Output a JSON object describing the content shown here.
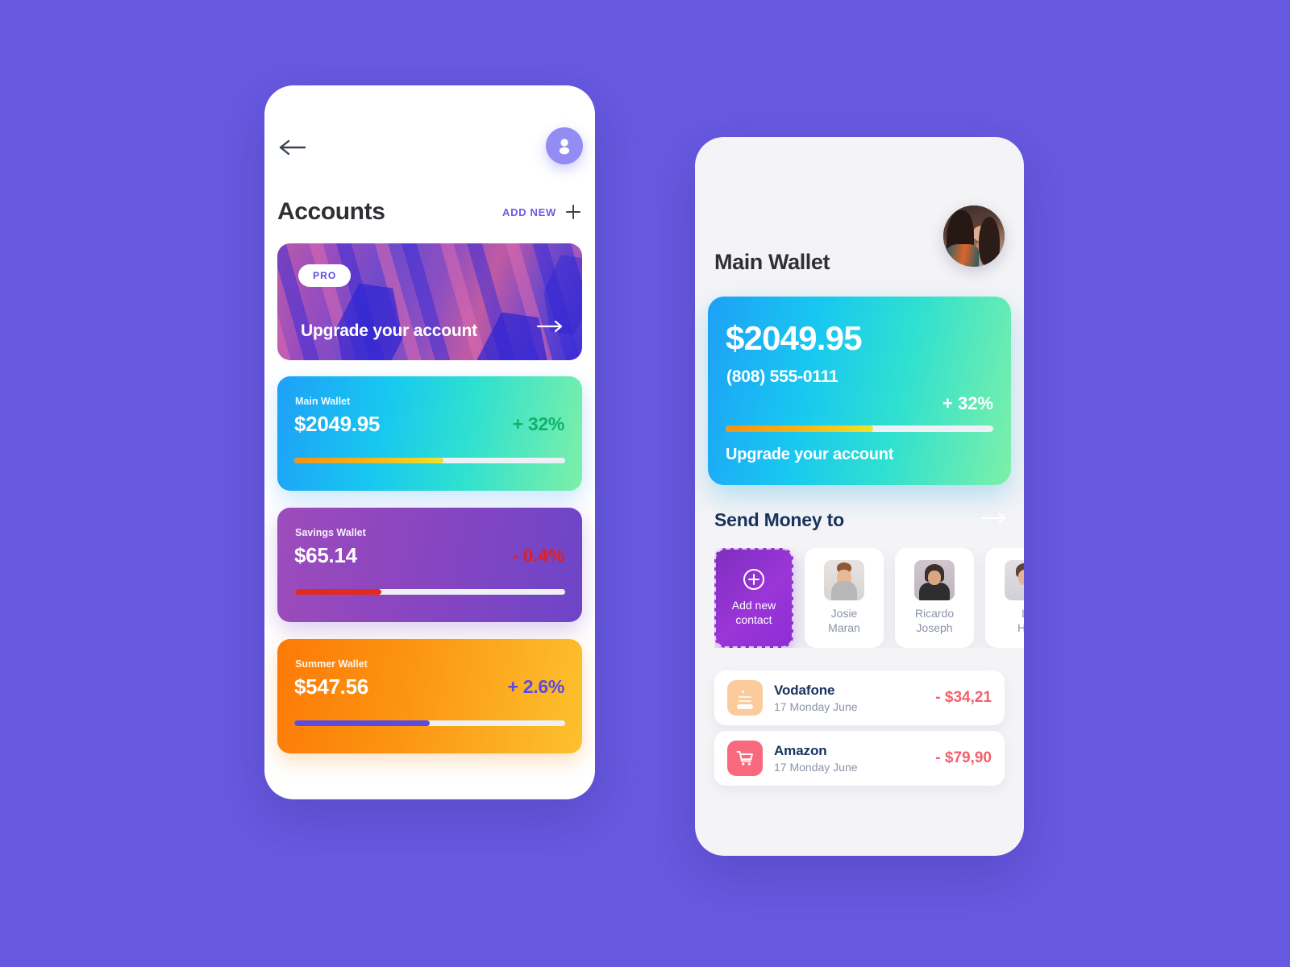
{
  "theme": {
    "background": "#6759E0",
    "accent_purple": "#6C5CE7",
    "positive_green": "#0FB36C",
    "negative_red": "#E02020",
    "txn_red": "#F4606C",
    "dark_navy": "#17325C",
    "muted_gray": "#8A93A8"
  },
  "accounts_screen": {
    "back_icon": "arrow-left-icon",
    "profile_icon": "person-icon",
    "title": "Accounts",
    "add_new_label": "ADD NEW",
    "add_new_icon": "plus-icon",
    "promo": {
      "badge": "PRO",
      "cta": "Upgrade your account",
      "arrow_icon": "arrow-right-icon"
    },
    "wallets": [
      {
        "name": "Main Wallet",
        "amount": "$2049.95",
        "delta": "+ 32%",
        "delta_sign": "positive",
        "progress_percent": 55,
        "bar_color": "#F3B019",
        "card_colors": [
          "#1EA0F7",
          "#7DF0A8"
        ]
      },
      {
        "name": "Savings Wallet",
        "amount": "$65.14",
        "delta": "- 0.4%",
        "delta_sign": "negative",
        "progress_percent": 32,
        "bar_color": "#E12B20",
        "card_colors": [
          "#9D4CBB",
          "#6D45C9"
        ]
      },
      {
        "name": "Summer Wallet",
        "amount": "$547.56",
        "delta": "+ 2.6%",
        "delta_sign": "neutral",
        "progress_percent": 50,
        "bar_color": "#5B4BE0",
        "card_colors": [
          "#FC7A07",
          "#FCC12E"
        ]
      }
    ]
  },
  "wallet_screen": {
    "avatar_icon": "user-avatar-photo",
    "title": "Main Wallet",
    "hero": {
      "amount": "$2049.95",
      "phone": "(808) 555-0111",
      "delta": "+ 32%",
      "progress_percent": 55,
      "cta": "Upgrade your account"
    },
    "send_money": {
      "title": "Send Money to",
      "arrow_icon": "arrow-right-icon",
      "add_contact": {
        "label": "Add new\ncontact",
        "label_line1": "Add new",
        "label_line2": "contact",
        "icon": "plus-circle-icon"
      },
      "contacts": [
        {
          "line1": "Josie",
          "line2": "Maran",
          "photo": "woman-bun-photo"
        },
        {
          "line1": "Ricardo",
          "line2": "Joseph",
          "photo": "man-beard-photo"
        },
        {
          "line1": "L",
          "line2": "Hu",
          "photo": "person-photo"
        }
      ]
    },
    "transactions": [
      {
        "merchant": "Vodafone",
        "date": "17 Monday June",
        "amount": "- $34,21",
        "icon": "receipt-icon",
        "icon_color": "#FBCB9C"
      },
      {
        "merchant": "Amazon",
        "date": "17 Monday June",
        "amount": "- $79,90",
        "icon": "shopping-cart-icon",
        "icon_color": "#F9697E"
      }
    ]
  }
}
